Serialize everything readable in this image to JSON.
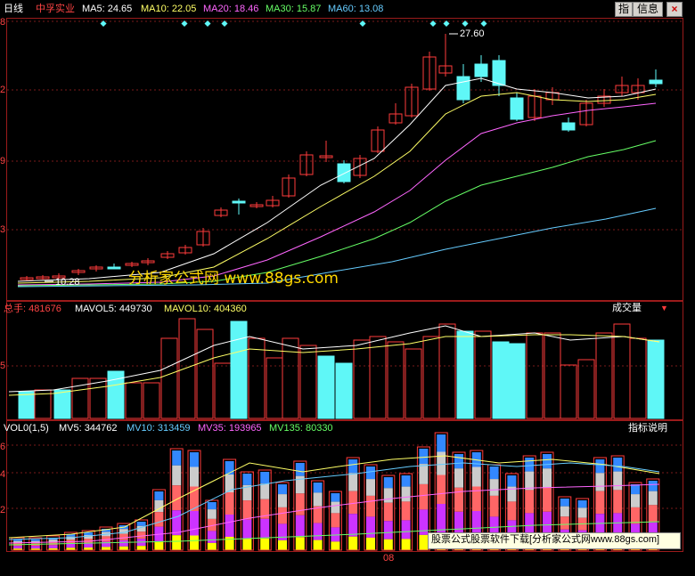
{
  "header": {
    "period": "日线",
    "stock_name": "中孚实业",
    "ma": [
      {
        "label": "MA5: 24.65",
        "color": "#ffffff"
      },
      {
        "label": "MA10: 22.05",
        "color": "#ffff66"
      },
      {
        "label": "MA20: 18.46",
        "color": "#ff66ff"
      },
      {
        "label": "MA30: 15.87",
        "color": "#66ff66"
      },
      {
        "label": "MA60: 13.08",
        "color": "#66ccff"
      }
    ],
    "buttons": {
      "zhi": "指",
      "info": "信息"
    }
  },
  "price_panel": {
    "axis_labels": [
      "8",
      "2",
      "9",
      "3"
    ],
    "high_label": "27.60",
    "low_label": "10.28",
    "watermark": "分析家公式网 www.88gs.com"
  },
  "volume_panel": {
    "header": [
      {
        "label": "总手: 481676",
        "color": "#ff4444"
      },
      {
        "label": "MAVOL5: 449730",
        "color": "#ffffff"
      },
      {
        "label": "MAVOL10: 404360",
        "color": "#ffff66"
      }
    ],
    "dropdown_label": "成交量",
    "axis_labels": [
      "5"
    ]
  },
  "vol_indicator_panel": {
    "header": [
      {
        "label": "VOL0(1,5)",
        "color": "#ffffff"
      },
      {
        "label": "MV5: 344762",
        "color": "#ffffff"
      },
      {
        "label": "MV10: 313459",
        "color": "#66ccff"
      },
      {
        "label": "MV35: 193965",
        "color": "#ff66ff"
      },
      {
        "label": "MV135: 80330",
        "color": "#66ff66"
      }
    ],
    "help_label": "指标说明",
    "axis_labels": [
      "6",
      "4",
      "2"
    ],
    "date_label": "08",
    "footer_text": "股票公式股票软件下载[分析家公式网www.88gs.com]"
  },
  "colors": {
    "up": "#ff3b3b",
    "down": "#5ff7f7",
    "frame": "#9b1b1b"
  }
}
